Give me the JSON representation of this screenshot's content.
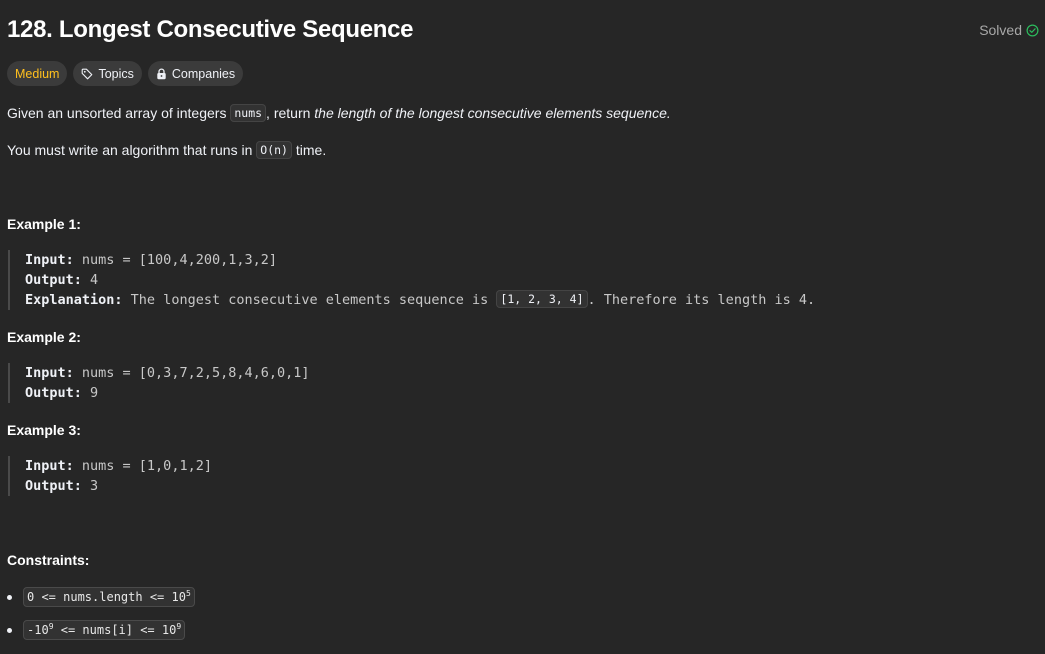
{
  "problem": {
    "title": "128. Longest Consecutive Sequence",
    "status": "Solved",
    "tags": {
      "difficulty": "Medium",
      "topics": "Topics",
      "companies": "Companies"
    },
    "description": {
      "p1_prefix": "Given an unsorted array of integers ",
      "p1_code": "nums",
      "p1_mid": ", return ",
      "p1_italic": "the length of the longest consecutive elements sequence.",
      "p2_prefix": "You must write an algorithm that runs in ",
      "p2_code": "O(n)",
      "p2_suffix": " time."
    },
    "examples": [
      {
        "heading": "Example 1:",
        "input_label": "Input:",
        "input_value": " nums = [100,4,200,1,3,2]",
        "output_label": "Output:",
        "output_value": " 4",
        "explanation_label": "Explanation:",
        "explanation_prefix": " The longest consecutive elements sequence is ",
        "explanation_code": "[1, 2, 3, 4]",
        "explanation_suffix": ". Therefore its length is 4."
      },
      {
        "heading": "Example 2:",
        "input_label": "Input:",
        "input_value": " nums = [0,3,7,2,5,8,4,6,0,1]",
        "output_label": "Output:",
        "output_value": " 9"
      },
      {
        "heading": "Example 3:",
        "input_label": "Input:",
        "input_value": " nums = [1,0,1,2]",
        "output_label": "Output:",
        "output_value": " 3"
      }
    ],
    "constraints": {
      "heading": "Constraints:",
      "c1_text": "0 <= nums.length <= 10",
      "c1_sup": "5",
      "c2_part1": "-10",
      "c2_sup1": "9",
      "c2_part2": " <= nums[i] <= 10",
      "c2_sup2": "9"
    }
  },
  "colors": {
    "background": "#262626",
    "medium": "#ffc01e",
    "solved_check": "#2cbb5d"
  },
  "icons": [
    "check-circle-icon",
    "tag-icon",
    "lock-icon"
  ]
}
